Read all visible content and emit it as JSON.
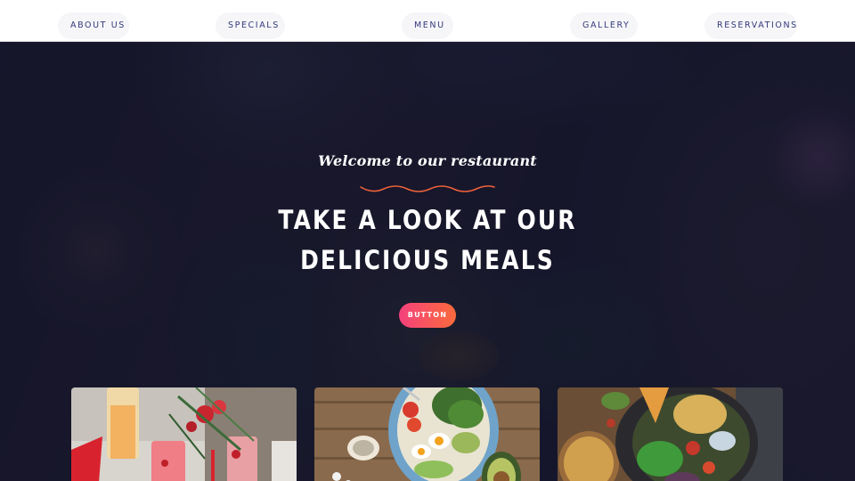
{
  "nav": {
    "items": [
      {
        "label": "ABOUT US"
      },
      {
        "label": "SPECIALS"
      },
      {
        "label": "MENU"
      },
      {
        "label": "GALLERY"
      },
      {
        "label": "RESERVATIONS"
      }
    ]
  },
  "hero": {
    "tagline": "Welcome to our restaurant",
    "headline_line1": "TAKE A LOOK AT OUR",
    "headline_line2": "DELICIOUS MEALS",
    "button_label": "BUTTON"
  },
  "colors": {
    "nav_text": "#343a7a",
    "overlay": "#10122e",
    "wave_accent": "#f0623a",
    "button_gradient_start": "#f5417d",
    "button_gradient_end": "#fb6a3b"
  },
  "cards": [
    {
      "image": "drinks-image"
    },
    {
      "image": "egg-salad-bowl-image"
    },
    {
      "image": "chickpea-bowl-image"
    }
  ]
}
